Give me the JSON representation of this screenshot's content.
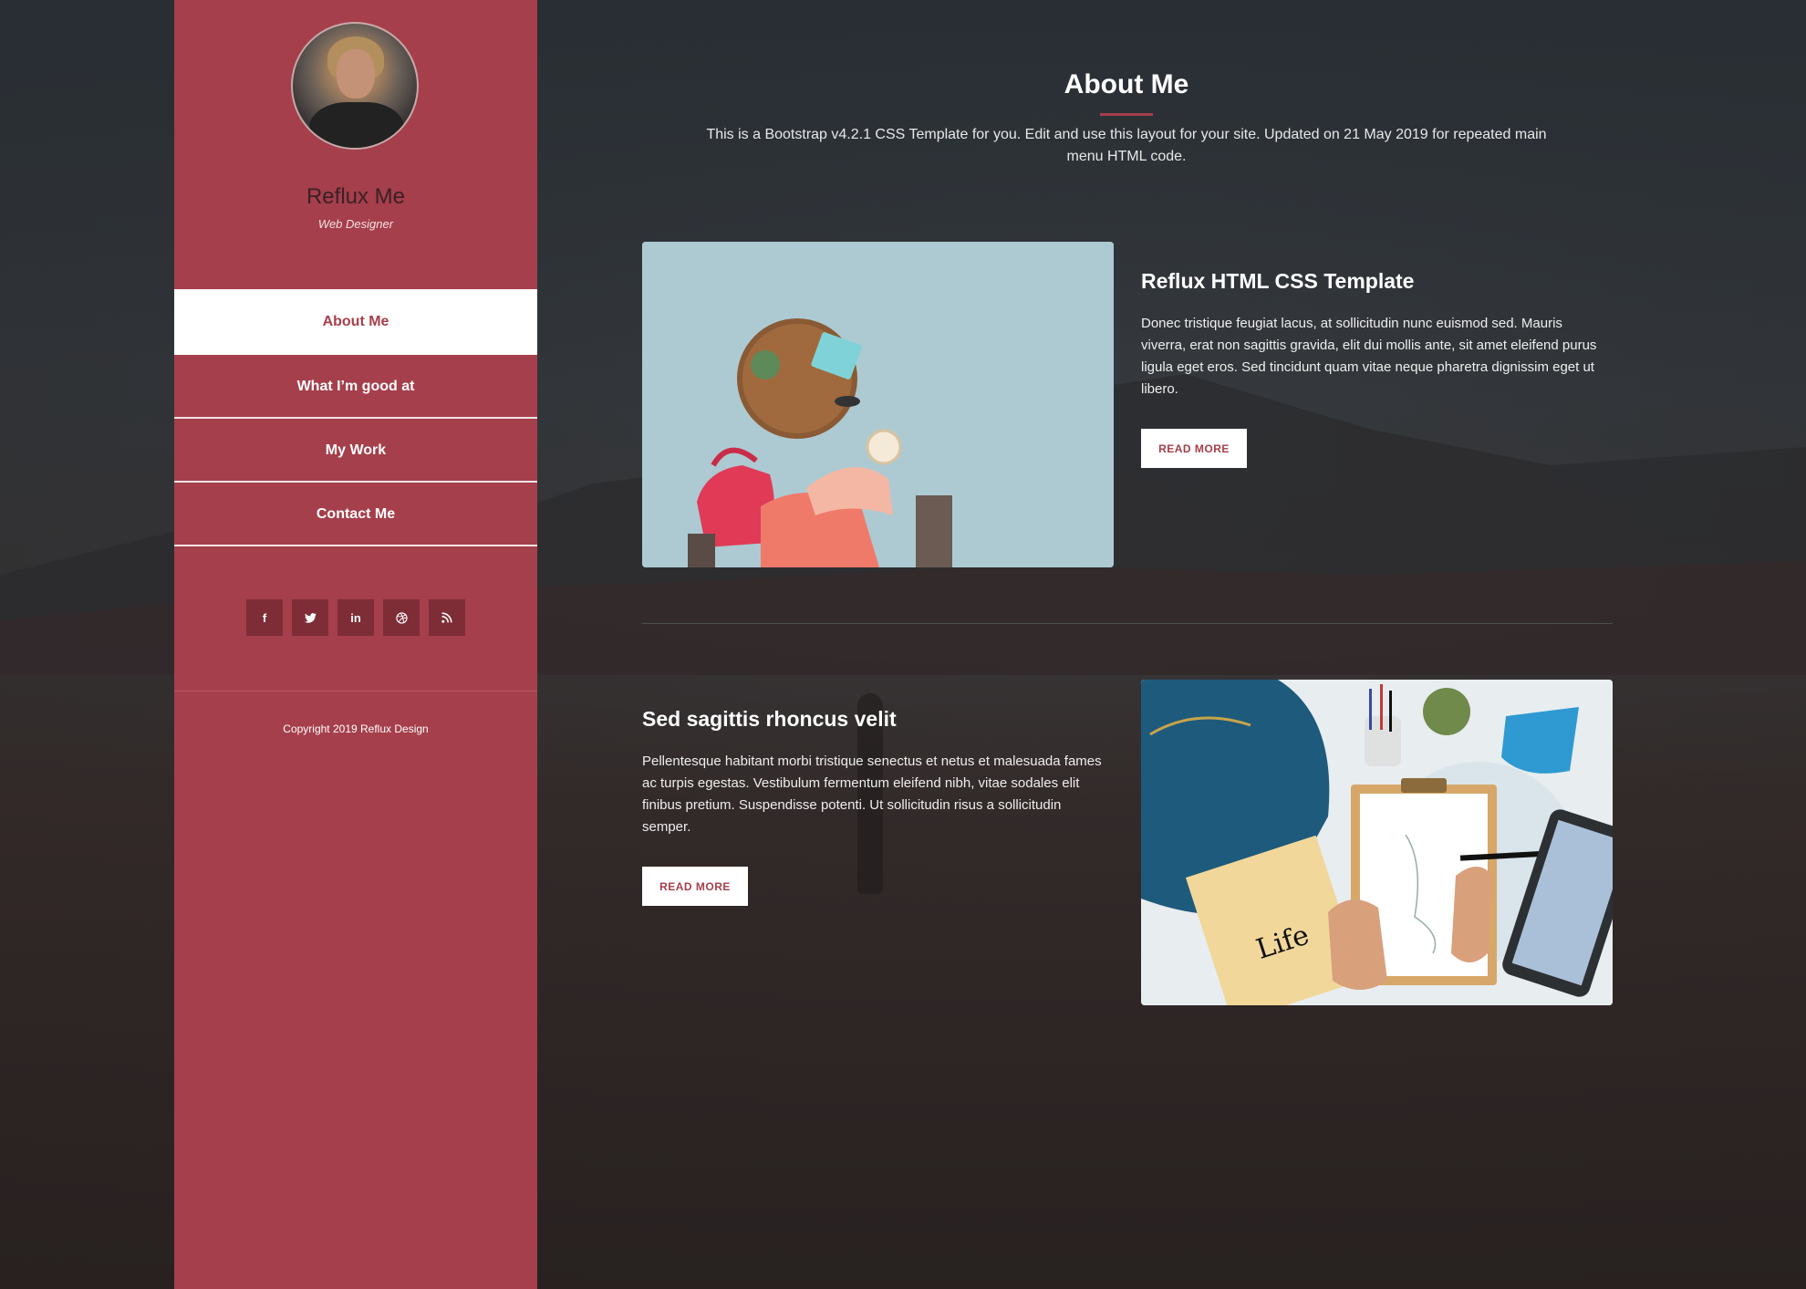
{
  "profile": {
    "name": "Reflux Me",
    "role": "Web Designer"
  },
  "nav": {
    "items": [
      {
        "label": "About Me",
        "active": true
      },
      {
        "label": "What I’m good at",
        "active": false
      },
      {
        "label": "My Work",
        "active": false
      },
      {
        "label": "Contact Me",
        "active": false
      }
    ]
  },
  "social": {
    "icons": [
      {
        "name": "facebook-icon",
        "glyph": "f"
      },
      {
        "name": "twitter-icon",
        "glyph": "🐦"
      },
      {
        "name": "linkedin-icon",
        "glyph": "in"
      },
      {
        "name": "dribbble-icon",
        "glyph": "◎"
      },
      {
        "name": "rss-icon",
        "glyph": "◝"
      }
    ]
  },
  "footer": {
    "copyright": "Copyright 2019 Reflux Design"
  },
  "main": {
    "title": "About Me",
    "intro": "This is a Bootstrap v4.2.1 CSS Template for you. Edit and use this layout for your site. Updated on 21 May 2019 for repeated main menu HTML code.",
    "sections": [
      {
        "heading": "Reflux HTML CSS Template",
        "text": "Donec tristique feugiat lacus, at sollicitudin nunc euismod sed. Mauris viverra, erat non sagittis gravida, elit dui mollis ante, sit amet eleifend purus ligula eget eros. Sed tincidunt quam vitae neque pharetra dignissim eget ut libero.",
        "button": "READ MORE"
      },
      {
        "heading": "Sed sagittis rhoncus velit",
        "text": "Pellentesque habitant morbi tristique senectus et netus et malesuada fames ac turpis egestas. Vestibulum fermentum eleifend nibh, vitae sodales elit finibus pretium. Suspendisse potenti. Ut sollicitudin risus a sollicitudin semper.",
        "button": "READ MORE"
      }
    ]
  },
  "colors": {
    "accent": "#a53f4b",
    "background": "#2a2d31"
  }
}
